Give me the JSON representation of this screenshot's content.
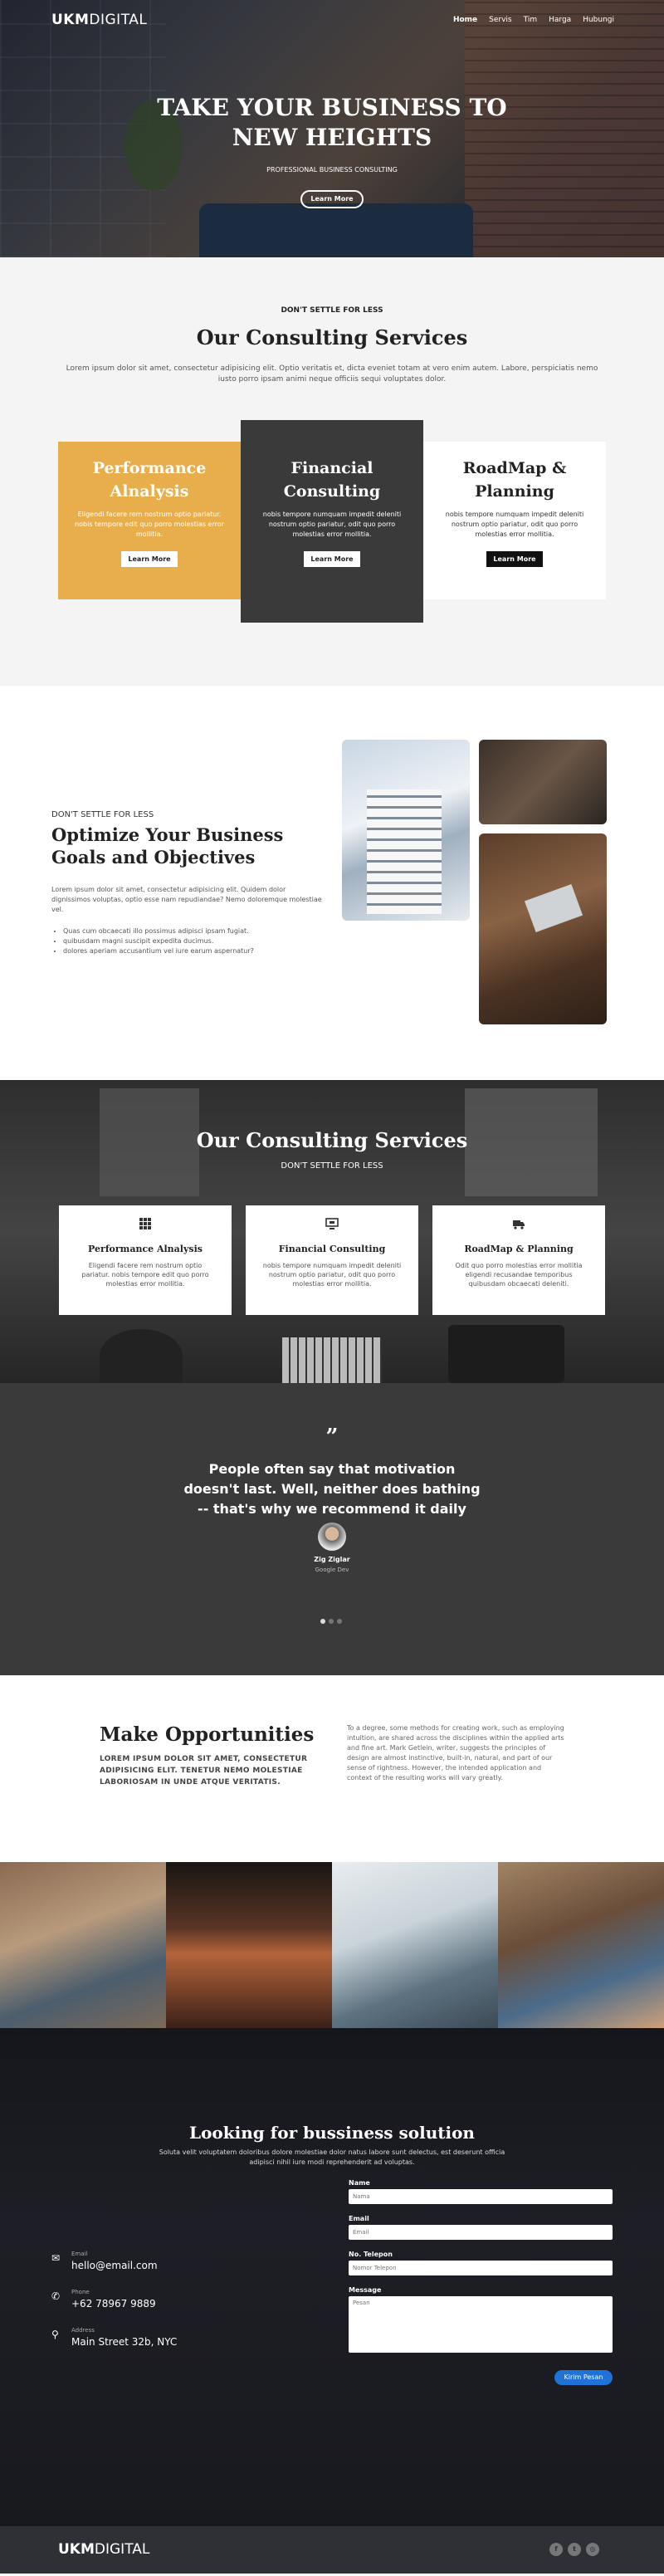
{
  "nav": {
    "logo_bold": "UKM",
    "logo_thin": "DIGITAL",
    "links": [
      "Home",
      "Servis",
      "Tim",
      "Harga",
      "Hubungi"
    ]
  },
  "hero": {
    "title_line1": "TAKE YOUR BUSINESS TO",
    "title_line2": "NEW HEIGHTS",
    "subtitle": "PROFESSIONAL BUSINESS CONSULTING",
    "button": "Learn More"
  },
  "services": {
    "eyebrow": "DON'T SETTLE FOR LESS",
    "title": "Our Consulting Services",
    "description": "Lorem ipsum dolor sit amet, consectetur adipisicing elit. Optio veritatis et, dicta eveniet totam at vero enim autem. Labore, perspiciatis nemo iusto porro ipsam animi neque officiis sequi voluptates dolor.",
    "cards": [
      {
        "title_line1": "Performance",
        "title_line2": "Alnalysis",
        "text": "Eligendi facere rem nostrum optio pariatur. nobis tempore edit quo porro molestias error mollitia.",
        "button": "Learn More"
      },
      {
        "title_line1": "Financial",
        "title_line2": "Consulting",
        "text": "nobis tempore numquam impedit deleniti nostrum optio pariatur, odit quo porro molestias error mollitia.",
        "button": "Learn More"
      },
      {
        "title_line1": "RoadMap &",
        "title_line2": "Planning",
        "text": "nobis tempore numquam impedit deleniti nostrum optio pariatur, odit quo porro molestias error mollitia.",
        "button": "Learn More"
      }
    ]
  },
  "optimize": {
    "eyebrow": "DON'T SETTLE FOR LESS",
    "title_line1": "Optimize Your Business",
    "title_line2": "Goals and Objectives",
    "description": "Lorem ipsum dolor sit amet, consectetur adipisicing elit. Quidem dolor dignissimos voluptas, optio esse nam repudiandae? Nemo doloremque molestiae vel.",
    "bullets": [
      "Quas cum obcaecati illo possimus adipisci ipsam fugiat.",
      "quibusdam magni suscipit expedita ducimus.",
      "dolores aperiam accusantium vel iure earum aspernatur?"
    ]
  },
  "dark_services": {
    "title": "Our Consulting Services",
    "subtitle": "DON'T SETTLE FOR LESS",
    "cards": [
      {
        "icon": "grid-icon",
        "title": "Performance Alnalysis",
        "text": "Eligendi facere rem nostrum optio pariatur. nobis tempore edit quo porro molestias error mollitia."
      },
      {
        "icon": "monitor-icon",
        "title": "Financial Consulting",
        "text": "nobis tempore numquam impedit deleniti nostrum optio pariatur, odit quo porro molestias error mollitia."
      },
      {
        "icon": "truck-icon",
        "title": "RoadMap & Planning",
        "text": "Odit quo porro molestias error mollitia eligendi recusandae temporibus quibusdam obcaecati deleniti."
      }
    ]
  },
  "testimonial": {
    "quote_mark": "”",
    "quote_line1": "People often say that motivation",
    "quote_line2": "doesn't last. Well, neither does bathing",
    "quote_line3": "-- that's why we recommend it daily",
    "name": "Zig Ziglar",
    "role": "Google Dev"
  },
  "opportunities": {
    "title": "Make Opportunities",
    "lead": "LOREM IPSUM DOLOR SIT AMET, CONSECTETUR ADIPISICING ELIT. TENETUR NEMO MOLESTIAE LABORIOSAM IN UNDE ATQUE VERITATIS.",
    "body": "To a degree, some methods for creating work, such as employing intuition, are shared across the disciplines within the applied arts and fine art. Mark Getlein, writer, suggests the principles of design are almost instinctive, built-in, natural, and part of our sense of rightness. However, the intended application and context of the resulting works will vary greatly."
  },
  "contact": {
    "title": "Looking for bussiness solution",
    "subtitle": "Soluta velit voluptatem doloribus dolore molestiae dolor natus labore sunt delectus, est deserunt officia adipisci nihil iure modi reprehenderit ad voluptas.",
    "info": [
      {
        "icon": "mail-icon",
        "label": "Email",
        "value": "hello@email.com"
      },
      {
        "icon": "phone-icon",
        "label": "Phone",
        "value": "+62 78967 9889"
      },
      {
        "icon": "location-icon",
        "label": "Address",
        "value": "Main Street 32b, NYC"
      }
    ],
    "form": {
      "name_label": "Name",
      "name_placeholder": "Nama",
      "email_label": "Email",
      "email_placeholder": "Email",
      "phone_label": "No. Telepon",
      "phone_placeholder": "Nomor Telepon",
      "message_label": "Message",
      "message_placeholder": "Pesan",
      "submit": "Kirim Pesan"
    }
  },
  "footer": {
    "logo_bold": "UKM",
    "logo_thin": "DIGITAL",
    "social": [
      "facebook-icon",
      "twitter-icon",
      "instagram-icon"
    ]
  }
}
